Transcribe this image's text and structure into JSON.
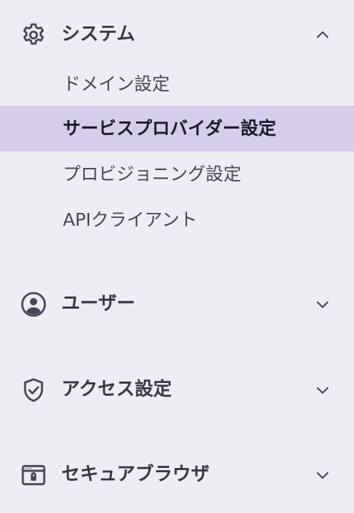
{
  "sections": [
    {
      "label": "システム",
      "icon": "gear-icon",
      "expanded": true,
      "items": [
        {
          "label": "ドメイン設定"
        },
        {
          "label": "サービスプロバイダー設定",
          "active": true
        },
        {
          "label": "プロビジョニング設定"
        },
        {
          "label": "APIクライアント"
        }
      ]
    },
    {
      "label": "ユーザー",
      "icon": "user-circle-icon",
      "expanded": false
    },
    {
      "label": "アクセス設定",
      "icon": "shield-check-icon",
      "expanded": false
    },
    {
      "label": "セキュアブラウザ",
      "icon": "browser-lock-icon",
      "expanded": false
    }
  ],
  "colors": {
    "background": "#efedf4",
    "active_background": "#d6cdec",
    "text": "#3a3645",
    "active_text": "#1e1a28"
  }
}
